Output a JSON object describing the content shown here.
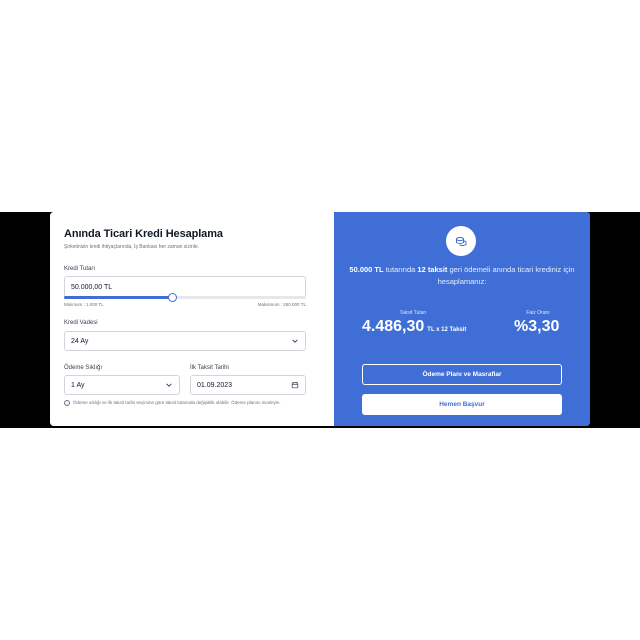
{
  "calculator": {
    "title": "Anında Ticari Kredi Hesaplama",
    "subtitle": "Şirketinizin kredi ihtiyaçlarında, İş Bankası her zaman sizinle.",
    "loan_amount": {
      "label": "Kredi Tutarı",
      "value": "50.000,00 TL",
      "slider_fraction": 0.45,
      "min_label": "Minimum : 1.000 TL",
      "max_label": "Maksimum : 250.000 TL"
    },
    "term": {
      "label": "Kredi Vadesi",
      "selected": "24 Ay"
    },
    "frequency": {
      "label": "Ödeme Sıklığı",
      "selected": "1 Ay"
    },
    "first_date": {
      "label": "İlk Taksit Tarihi",
      "value": "01.09.2023"
    },
    "note": "Ödeme sıklığı ve ilk taksit tarihi seçimine göre taksit tutarında değişiklik olabilir. Ödeme planını inceleyin."
  },
  "results": {
    "summary_amount": "50.000 TL",
    "summary_mid": "tutarında",
    "summary_installments": "12 taksit",
    "summary_rest": "geri ödemeli anında ticari krediniz için hesaplamanız:",
    "installment_label": "Taksit Tutarı",
    "installment_value": "4.486,30",
    "installment_unit": "TL x 12 Taksit",
    "rate_label": "Faiz Oranı",
    "rate_value": "%3,30",
    "plan_button": "Ödeme Planı ve Masraflar",
    "apply_button": "Hemen Başvur"
  },
  "colors": {
    "accent": "#3f6fd6",
    "panel_text": "#ffffff"
  },
  "icons": {
    "header_icon": "coins-icon",
    "dropdown": "chevron-down-icon",
    "date": "calendar-icon",
    "note": "info-icon"
  }
}
